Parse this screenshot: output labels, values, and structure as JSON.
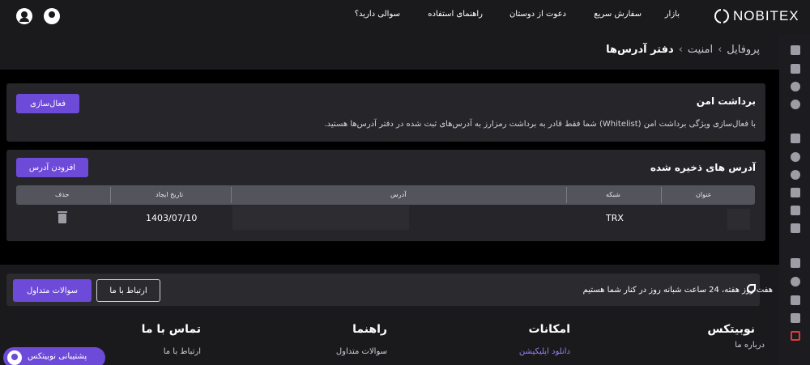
{
  "header": {
    "logo_text": "NOBITEX",
    "nav": [
      "بازار",
      "سفارش سریع",
      "دعوت از دوستان",
      "راهنمای استفاده",
      "سوالی دارید؟"
    ]
  },
  "breadcrumb": [
    "پروفایل",
    "امنیت",
    "دفتر آدرس‌ها"
  ],
  "safe_withdraw": {
    "title": "برداشت امن",
    "description": "با فعال‌سازی ویژگی برداشت امن (Whitelist) شما فقط قادر به برداشت رمزارز به آدرس‌های ثبت شده در دفتر آدرس‌ها هستید.",
    "activate_label": "فعال‌سازی"
  },
  "saved_addresses": {
    "title": "آدرس های ذخیره شده",
    "add_label": "افزودن آدرس",
    "columns": [
      "عنوان",
      "شبکه",
      "آدرس",
      "تاریخ ایجاد",
      "حذف"
    ],
    "rows": [
      {
        "network": "TRX",
        "created": "1403/07/10"
      }
    ]
  },
  "footer": {
    "support_text": "هفت روز هفته، 24 ساعت شبانه روز در کنار شما هستیم",
    "contact_label": "ارتباط با ما",
    "faq_label": "سوالات متداول",
    "columns": [
      {
        "title": "نوبیتکس",
        "links": [
          "درباره ما"
        ]
      },
      {
        "title": "امکانات",
        "links": [
          "دانلود اپلیکیشن"
        ]
      },
      {
        "title": "راهنما",
        "links": [
          "سوالات متداول"
        ]
      },
      {
        "title": "تماس با ما",
        "links": [
          "ارتباط با ما"
        ]
      }
    ],
    "support_float_label": "پشتیبانی نوبیتکس"
  },
  "colors": {
    "accent": "#6e4ad8",
    "background": "#000000",
    "panel": "#25252a"
  }
}
